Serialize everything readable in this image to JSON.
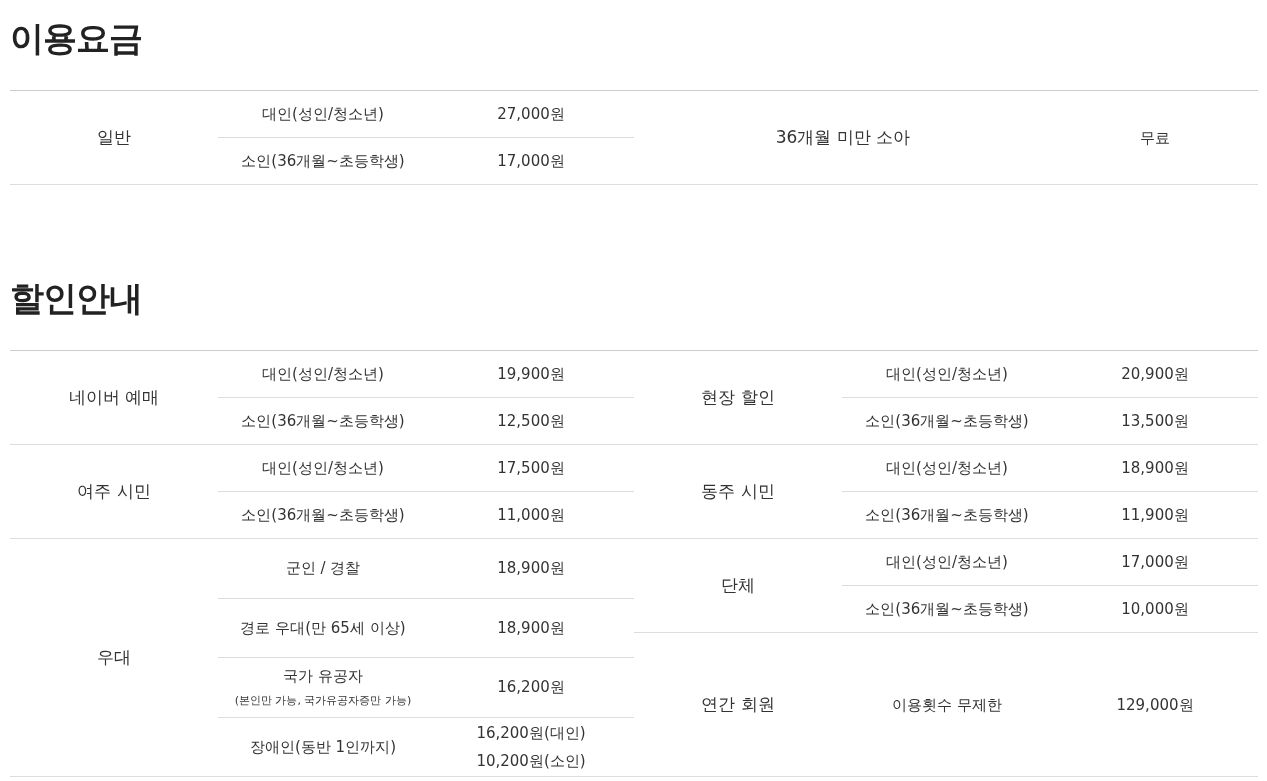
{
  "sections": [
    {
      "title": "이용요금",
      "left": [
        {
          "label": "일반",
          "items": [
            {
              "type": "대인(성인/청소년)",
              "price": "27,000원"
            },
            {
              "type": "소인(36개월~초등학생)",
              "price": "17,000원"
            }
          ]
        }
      ],
      "right": [
        {
          "label": "36개월 미만 소아",
          "kind": "wide",
          "items": [
            {
              "price": "무료"
            }
          ]
        }
      ]
    },
    {
      "title": "할인안내",
      "left": [
        {
          "label": "네이버 예매",
          "items": [
            {
              "type": "대인(성인/청소년)",
              "price": "19,900원"
            },
            {
              "type": "소인(36개월~초등학생)",
              "price": "12,500원"
            }
          ]
        },
        {
          "label": "여주 시민",
          "items": [
            {
              "type": "대인(성인/청소년)",
              "price": "17,500원"
            },
            {
              "type": "소인(36개월~초등학생)",
              "price": "11,000원"
            }
          ]
        },
        {
          "label": "우대",
          "items": [
            {
              "type": "군인 / 경찰",
              "price": "18,900원"
            },
            {
              "type": "경로 우대(만 65세 이상)",
              "price": "18,900원"
            },
            {
              "type": "국가 유공자",
              "note": "(본인만 가능, 국가유공자증만 가능)",
              "price": "16,200원"
            },
            {
              "type": "장애인(동반 1인까지)",
              "prices": [
                "16,200원(대인)",
                "10,200원(소인)"
              ]
            }
          ]
        }
      ],
      "right": [
        {
          "label": "현장 할인",
          "items": [
            {
              "type": "대인(성인/청소년)",
              "price": "20,900원"
            },
            {
              "type": "소인(36개월~초등학생)",
              "price": "13,500원"
            }
          ]
        },
        {
          "label": "동주 시민",
          "items": [
            {
              "type": "대인(성인/청소년)",
              "price": "18,900원"
            },
            {
              "type": "소인(36개월~초등학생)",
              "price": "11,900원"
            }
          ]
        },
        {
          "label": "단체",
          "items": [
            {
              "type": "대인(성인/청소년)",
              "price": "17,000원"
            },
            {
              "type": "소인(36개월~초등학생)",
              "price": "10,000원"
            }
          ]
        },
        {
          "label": "연간 회원",
          "items": [
            {
              "type": "이용횟수 무제한",
              "price": "129,000원"
            }
          ]
        }
      ]
    }
  ]
}
